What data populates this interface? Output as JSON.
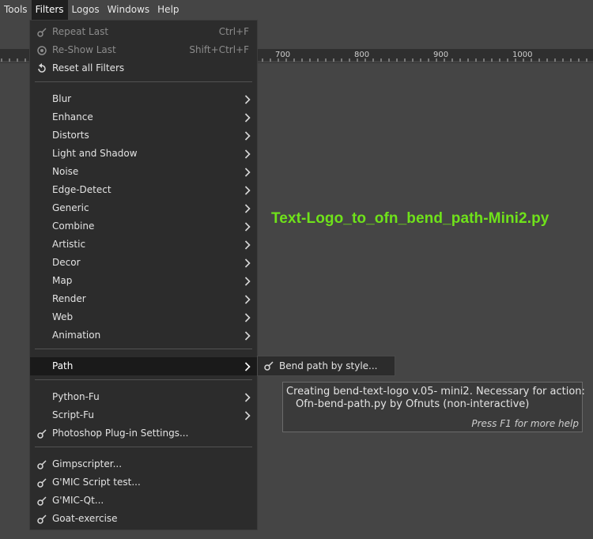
{
  "menubar": {
    "items": [
      "Tools",
      "Filters",
      "Logos",
      "Windows",
      "Help"
    ]
  },
  "ruler": {
    "labels": [
      "700",
      "800",
      "900",
      "1000"
    ]
  },
  "canvas": {
    "logo_text": "Text-Logo_to_ofn_bend_path-Mini2.py",
    "logo_color": "#6fe21a"
  },
  "filters_menu": {
    "repeat_last": {
      "label": "Repeat Last",
      "accel": "Ctrl+F"
    },
    "reshow_last": {
      "label": "Re-Show Last",
      "accel": "Shift+Ctrl+F"
    },
    "reset_all": {
      "label": "Reset all Filters"
    },
    "categories": [
      "Blur",
      "Enhance",
      "Distorts",
      "Light and Shadow",
      "Noise",
      "Edge-Detect",
      "Generic",
      "Combine",
      "Artistic",
      "Decor",
      "Map",
      "Render",
      "Web",
      "Animation"
    ],
    "path": "Path",
    "python_fu": "Python-Fu",
    "script_fu": "Script-Fu",
    "photoshop": "Photoshop Plug-in Settings...",
    "extras": [
      "Gimpscripter...",
      "G'MIC Script test...",
      "G'MIC-Qt...",
      "Goat-exercise"
    ]
  },
  "path_submenu": {
    "item": "Bend path by style..."
  },
  "tooltip": {
    "line1": "Creating bend-text-logo v.05- mini2. Necessary for action:",
    "line2": "Ofn-bend-path.py by Ofnuts (non-interactive)",
    "hint": "Press F1 for more help"
  },
  "colors": {
    "menu_bg": "#2c2c2c",
    "highlight_bg": "#1a1a1a",
    "app_bg": "#454545"
  }
}
